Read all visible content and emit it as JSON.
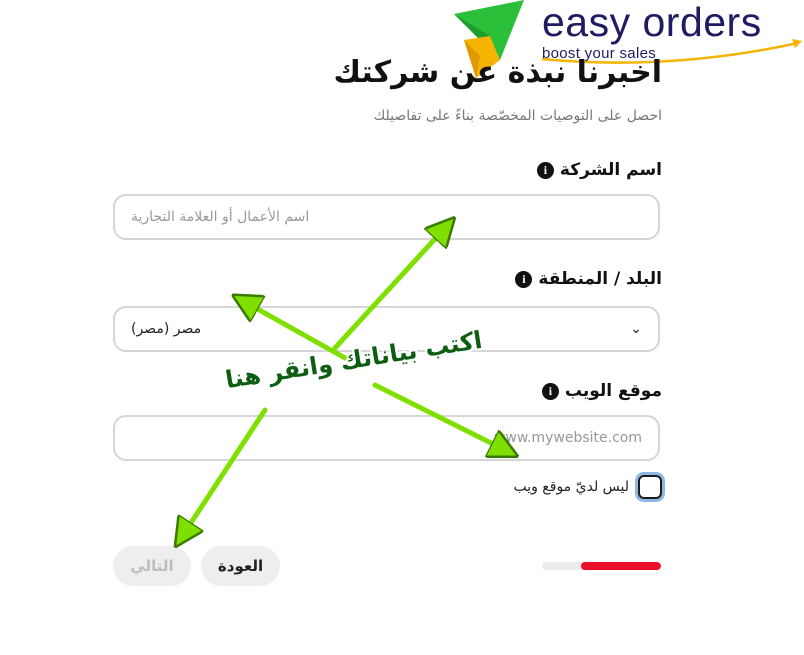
{
  "logo": {
    "brand_name": "easy orders",
    "tagline": "boost your sales",
    "colors": {
      "primary": "#1f1c63",
      "green": "#2ecc40",
      "yellow": "#f5b400"
    }
  },
  "header": {
    "title": "اخبرنا نبذة عن شركتك",
    "subtitle": "احصل على التوصيات المخصّصة بناءً على تفاصيلك"
  },
  "fields": {
    "company": {
      "label": "اسم الشركة",
      "placeholder": "اسم الأعمال أو العلامة التجارية",
      "info_icon": "info-icon"
    },
    "country": {
      "label": "البلد / المنطقة",
      "value": "مصر (مصر)",
      "info_icon": "info-icon"
    },
    "website": {
      "label": "موقع الويب",
      "placeholder": "www.mywebsite.com",
      "info_icon": "info-icon"
    }
  },
  "no_website": {
    "label": "ليس لديّ موقع ويب",
    "checked": false
  },
  "progress": {
    "value": 0.67,
    "color": "#e8102a"
  },
  "buttons": {
    "back": "العودة",
    "next": "التالي"
  },
  "annotation": {
    "text": "اكتب بياناتك وانقر هنا",
    "color": "#0d5e12",
    "arrow_color": "#7fe000"
  }
}
